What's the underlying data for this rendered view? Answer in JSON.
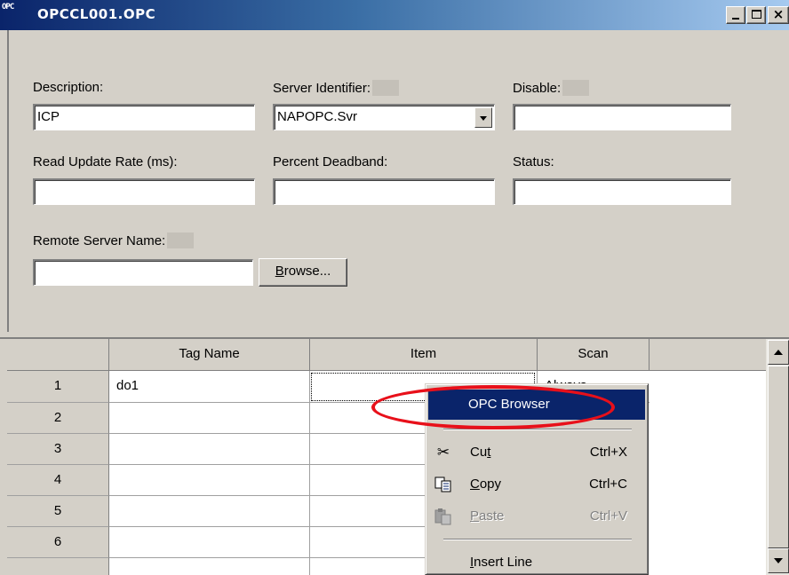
{
  "window": {
    "title": "OPCCL001.OPC",
    "icon_text": "OPC",
    "close_glyph": "×"
  },
  "form": {
    "description_label": "Description:",
    "description_value": "ICP",
    "server_identifier_label": "Server Identifier:",
    "server_identifier_value": "NAPOPC.Svr",
    "disable_label": "Disable:",
    "disable_value": "",
    "read_update_rate_label": "Read Update Rate (ms):",
    "read_update_rate_value": "",
    "percent_deadband_label": "Percent Deadband:",
    "percent_deadband_value": "",
    "status_label": "Status:",
    "status_value": "",
    "remote_server_name_label": "Remote Server Name:",
    "remote_server_name_value": "",
    "browse_button": {
      "mnemonic": "B",
      "rest": "rowse..."
    }
  },
  "grid": {
    "columns": [
      "Tag Name",
      "Item",
      "Scan"
    ],
    "rows": [
      {
        "num": "1",
        "tag_name": "do1",
        "item": "",
        "scan": "Always"
      },
      {
        "num": "2",
        "tag_name": "",
        "item": "",
        "scan": ""
      },
      {
        "num": "3",
        "tag_name": "",
        "item": "",
        "scan": ""
      },
      {
        "num": "4",
        "tag_name": "",
        "item": "",
        "scan": ""
      },
      {
        "num": "5",
        "tag_name": "",
        "item": "",
        "scan": ""
      },
      {
        "num": "6",
        "tag_name": "",
        "item": "",
        "scan": ""
      }
    ]
  },
  "context_menu": {
    "highlighted_item": "OPC Browser",
    "cut": {
      "pre": "Cu",
      "mnemonic": "t",
      "post": "",
      "shortcut": "Ctrl+X"
    },
    "copy": {
      "pre": "",
      "mnemonic": "C",
      "post": "opy",
      "shortcut": "Ctrl+C"
    },
    "paste": {
      "pre": "",
      "mnemonic": "P",
      "post": "aste",
      "shortcut": "Ctrl+V",
      "enabled": false
    },
    "insert_line": {
      "pre": "",
      "mnemonic": "I",
      "post": "nsert Line"
    }
  },
  "annotation_color": "#e8101a",
  "highlight_color": "#0a246a"
}
